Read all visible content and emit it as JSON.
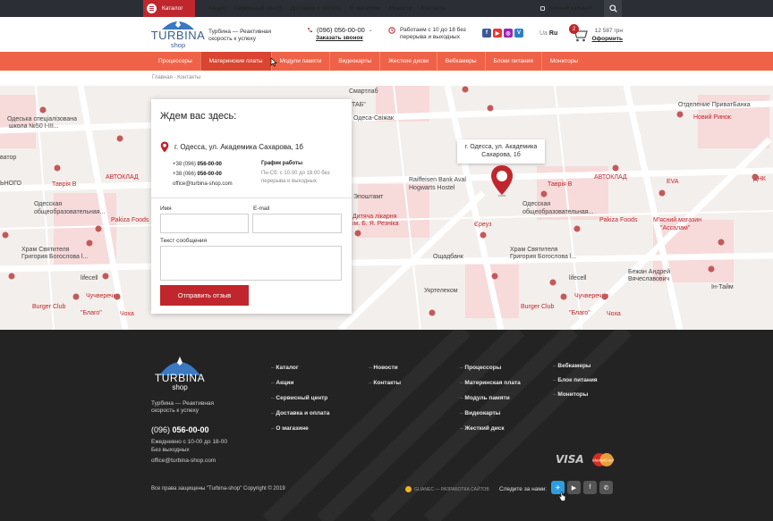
{
  "topbar": {
    "catalog_label": "Каталог",
    "nav": [
      "Акции",
      "Сервисный центр",
      "Доставка и оплата",
      "О магазине",
      "Новости",
      "Контакты"
    ],
    "account_label": "Личный кабинет"
  },
  "header": {
    "logo_text": "TURBINA",
    "logo_sub": "shop",
    "tagline": [
      "Турбина — Реактивная",
      "скорость к успеху"
    ],
    "phone": "(096) 056-00-00",
    "callback_label": "Заказать звонок",
    "hours": [
      "Работаем с 10 до 18 без",
      "перерыва и выходных"
    ],
    "social": [
      "f",
      "▶",
      "◎",
      "V"
    ],
    "lang": {
      "ua": "Ua",
      "ru": "Ru"
    },
    "cart": {
      "count": "2",
      "total": "12 587 грн",
      "checkout_label": "Оформить"
    }
  },
  "menu": [
    "Процессоры",
    "Материнские платы",
    "Модули памяти",
    "Видеокарты",
    "Жесткие диски",
    "Вебкамеры",
    "Блоки питания",
    "Мониторы"
  ],
  "breadcrumb": "Главная - Контакты",
  "map": {
    "tooltip": [
      "г. Одесса, ул. Академика",
      "Сахарова, 1б"
    ],
    "labels": [
      "Смартлаб",
      "ТАБ\"",
      "Одеська спеціалізована",
      "школа №50 I-III...",
      "Одеса-Свіжак",
      "Таврія В",
      "АВТОКЛАД",
      "Одесская",
      "общеобразовательная...",
      "Pakiza Foods",
      "Храм Святителя",
      "Григория Богослова l...",
      "lifecell",
      "Чучверечна",
      "Burger Club",
      "\"Благо\"",
      "Чоха",
      "Raiffeisen Bank Aval",
      "Hogwarts Hostel",
      "Ощадбанк",
      "Укртелеком",
      "Дитяча лікарня",
      "ім. Б. Я. Резніка",
      "М'ясний магазин",
      "\"Ассалам\"",
      "Бежан Андрей",
      "Вячеславович",
      "Ін-Тайм",
      "Новий Ринок",
      "Отделение ПриватБанка",
      "ДНК",
      "EVA",
      "Єреуз",
      "ватор",
      "ЬНОГО",
      "Эпоштамт"
    ]
  },
  "contact": {
    "title": "Ждем вас здесь:",
    "address": "г. Одесса, ул. Академика Сахарова, 1б",
    "phone1_prefix": "+38 (096) ",
    "phone1": "056-00-00",
    "phone2_prefix": "+38 (066) ",
    "phone2": "056-00-00",
    "email": "office@turbina-shop.com",
    "schedule_title": "График работы",
    "schedule": [
      "Пн-Сб: с 10.00 до 18.00 без",
      "перерыва и выходных"
    ],
    "form": {
      "name_label": "Имя",
      "email_label": "E-mail",
      "message_label": "Текст сообщения",
      "submit_label": "Отправить отзыв"
    }
  },
  "footer": {
    "logo_text": "TURBINA",
    "logo_sub": "shop",
    "tagline": [
      "Турбина — Реактивная",
      "скорость к успеху"
    ],
    "phone_prefix": "(096) ",
    "phone": "056-00-00",
    "hours": [
      "Ежедневно с 10-00 до 18-00",
      "Без выходных"
    ],
    "email": "office@turbina-shop.com",
    "col1": [
      "Каталог",
      "Акции",
      "Сервисный центр",
      "Доставка и оплата",
      "О магазине"
    ],
    "col2": [
      "Новости",
      "Контакты"
    ],
    "col3": [
      "Процессоры",
      "Материнская плата",
      "Модуль памяти",
      "Видеокарты",
      "Жесткий диск"
    ],
    "col4": [
      "Вебкамеры",
      "Блок питания",
      "Мониторы"
    ],
    "payments": {
      "visa": "VISA",
      "mastercard": "MasterCard"
    },
    "copyright": "Все права защищены \"Turbina-shop\" Copyright © 2019",
    "developer": "GLIANEC — РАЗРАБОТКА САЙТОВ",
    "follow_label": "Следите за нами:",
    "social": [
      "✈",
      "▶",
      "f",
      "✆"
    ]
  }
}
